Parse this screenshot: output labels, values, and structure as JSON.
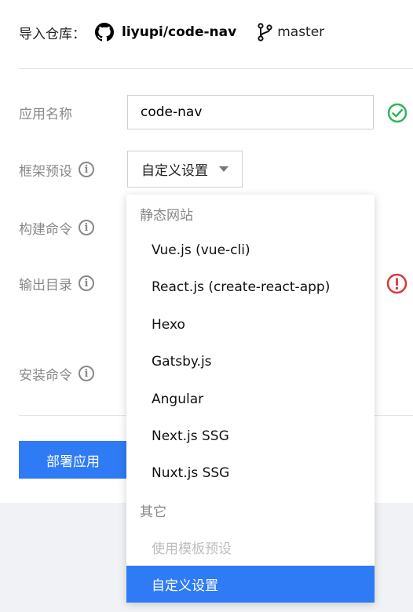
{
  "repo": {
    "label": "导入仓库：",
    "name": "liyupi/code-nav",
    "branch": "master"
  },
  "form": {
    "app_name_label": "应用名称",
    "app_name_value": "code-nav",
    "framework_label": "框架预设",
    "framework_value": "自定义设置",
    "build_label": "构建命令",
    "output_label": "输出目录",
    "install_label": "安装命令"
  },
  "actions": {
    "deploy_label": "部署应用"
  },
  "dropdown": {
    "group_static": "静态网站",
    "items": [
      "Vue.js (vue-cli)",
      "React.js (create-react-app)",
      "Hexo",
      "Gatsby.js",
      "Angular",
      "Next.js SSG",
      "Nuxt.js SSG"
    ],
    "group_other": "其它",
    "template_item": "使用模板预设",
    "custom_item": "自定义设置"
  },
  "colors": {
    "accent": "#2f7bf5",
    "success": "#2fb55a",
    "error": "#d9383b",
    "muted": "#888888"
  },
  "icons": {
    "repo": "github-icon",
    "branch": "git-branch-icon",
    "info": "info-icon",
    "valid": "check-circle-icon",
    "invalid": "exclamation-circle-icon"
  }
}
